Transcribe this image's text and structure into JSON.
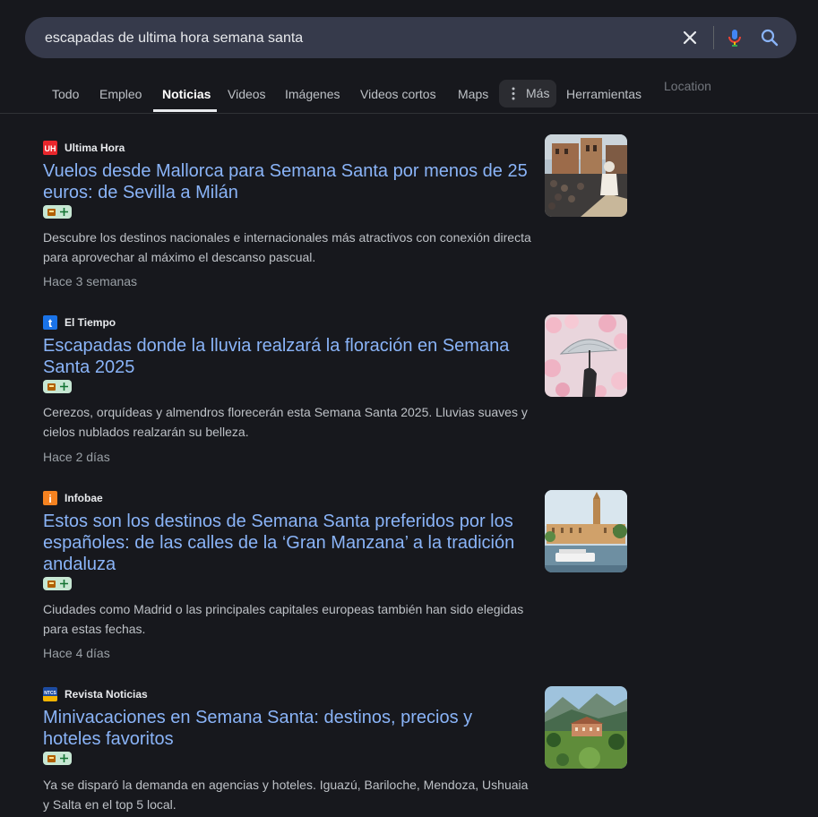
{
  "search": {
    "query": "escapadas de ultima hora semana santa",
    "clear_icon": "close-icon",
    "voice_icon": "microphone-icon",
    "search_icon": "search-icon"
  },
  "tabs": [
    {
      "label": "Todo"
    },
    {
      "label": "Empleo"
    },
    {
      "label": "Noticias",
      "active": true
    },
    {
      "label": "Videos"
    },
    {
      "label": "Imágenes"
    },
    {
      "label": "Videos cortos"
    },
    {
      "label": "Maps"
    }
  ],
  "more_tab": {
    "label": "Más",
    "icon": "more-vert-icon"
  },
  "tools_label": "Herramientas",
  "location_label": "Location",
  "articles": [
    {
      "source": "Ultima Hora",
      "favicon": "ultima-hora-logo",
      "favicon_text": "UH",
      "title": "Vuelos desde Mallorca para Semana Santa por menos de 25 euros: de Sevilla a Milán",
      "snippet": "Descubre los destinos nacionales e internacionales más atractivos con conexión directa para aprovechar al máximo el descanso pascual.",
      "date": "Hace 3 semanas",
      "thumbnail": "procession-photo"
    },
    {
      "source": "El Tiempo",
      "favicon": "el-tiempo-logo",
      "favicon_text": "t",
      "title": "Escapadas donde la lluvia realzará la floración en Semana Santa 2025",
      "snippet": "Cerezos, orquídeas y almendros florecerán esta Semana Santa 2025. Lluvias suaves y cielos nublados realzarán su belleza.",
      "date": "Hace 2 días",
      "thumbnail": "umbrella-blossoms-photo"
    },
    {
      "source": "Infobae",
      "favicon": "infobae-logo",
      "favicon_text": "i",
      "title": "Estos son los destinos de Semana Santa preferidos por los españoles: de las calles de la ‘Gran Manzana’ a la tradición andaluza",
      "snippet": "Ciudades como Madrid o las principales capitales europeas también han sido elegidas para estas fechas.",
      "date": "Hace 4 días",
      "thumbnail": "seville-river-photo"
    },
    {
      "source": "Revista Noticias",
      "favicon": "revista-noticias-logo",
      "favicon_text": "NTCS",
      "title": "Minivacaciones en Semana Santa: destinos, precios y hoteles favoritos",
      "snippet": "Ya se disparó la demanda en agencias y hoteles. Iguazú, Bariloche, Mendoza, Ushuaia y Salta en el top 5 local.",
      "date": "",
      "thumbnail": "mountain-hotel-photo"
    }
  ],
  "colors": {
    "background": "#17181d",
    "search_bg": "#363a4b",
    "link": "#8ab4f8",
    "text": "#bdc1c6",
    "muted": "#9aa0a6",
    "badge": "#c7e7d3"
  }
}
